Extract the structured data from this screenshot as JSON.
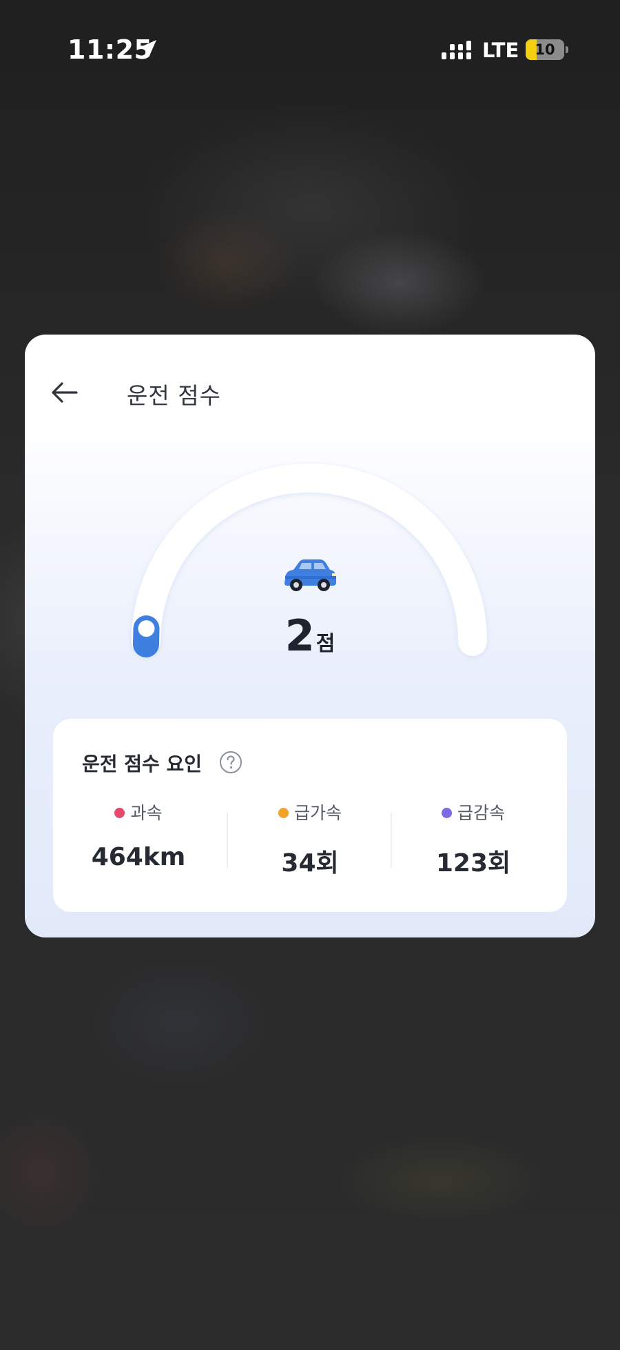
{
  "status_bar": {
    "time": "11:25",
    "network": "LTE",
    "battery_level": "10",
    "battery_fraction": 0.1,
    "icons": [
      "location-arrow-icon",
      "signal-icon",
      "battery-icon"
    ]
  },
  "card": {
    "title": "운전 점수",
    "back_icon": "back-arrow-icon",
    "score": {
      "value": "2",
      "unit": "점",
      "max": 100,
      "gauge_fraction": 0.02,
      "icon": "car-icon"
    },
    "factors": {
      "title": "운전 점수 요인",
      "help_icon": "question-mark-icon",
      "items": [
        {
          "label": "과속",
          "value": "464km",
          "color": "#e5486b"
        },
        {
          "label": "급가속",
          "value": "34회",
          "color": "#f2a22a"
        },
        {
          "label": "급감속",
          "value": "123회",
          "color": "#7b6be0"
        }
      ]
    }
  },
  "colors": {
    "accent": "#3e7fe0",
    "card_background": "#ffffff"
  }
}
